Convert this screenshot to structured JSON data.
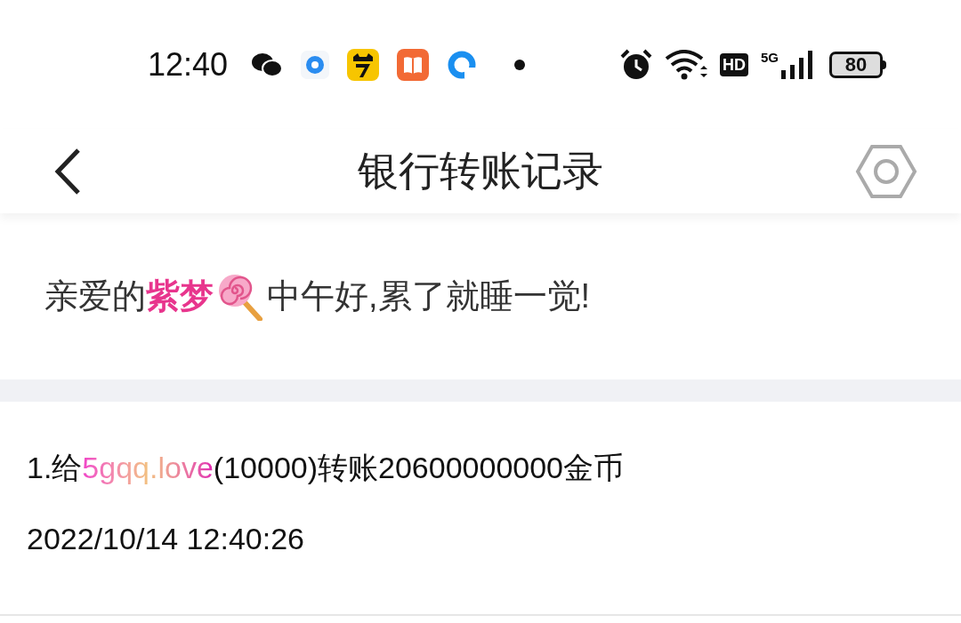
{
  "status_bar": {
    "time": "12:40",
    "hd": "HD",
    "network": "5G",
    "battery": "80"
  },
  "header": {
    "title": "银行转账记录"
  },
  "greeting": {
    "before": "亲爱的",
    "name": "紫梦",
    "message": "中午好,累了就睡一觉!"
  },
  "records": [
    {
      "prefix": "1.给",
      "recipient": "5gqq.love",
      "suffix": "(10000)转账20600000000金币",
      "time": "2022/10/14 12:40:26"
    }
  ]
}
